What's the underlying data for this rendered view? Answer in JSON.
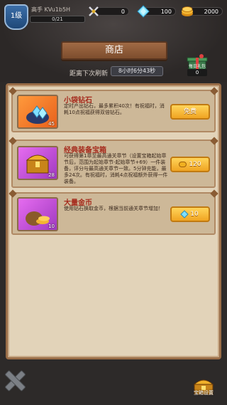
{
  "player": {
    "level": "1级",
    "name": "高手 KVu1b5H",
    "exp": "0/21"
  },
  "resources": {
    "energy": "0",
    "diamonds": "100",
    "gold": "2000"
  },
  "shop": {
    "title": "商店",
    "refresh_label": "距离下次刷新",
    "refresh_timer": "8小时6分43秒"
  },
  "gift": {
    "label": "每日礼包",
    "count": "0"
  },
  "items": [
    {
      "title": "小袋钻石",
      "description": "定时产出钻石，最多累积40次！有祝福时，消耗10点祝福获得双倍钻石。",
      "quantity": "45",
      "button": "免费"
    },
    {
      "title": "经典装备宝箱",
      "description": "可获得第1章至最高通关章节（设置宝箱起始章节后，范围为起始章节-起始章节+69）一件装备，评分与最高通关章节一致。5分钟充能，最多24次。有祝福时，消耗4点祝福额外获得一件装备。",
      "quantity": "28",
      "button": "120"
    },
    {
      "title": "大量金币",
      "description": "使用钻石换取金币，根据当前通关章节增加！",
      "quantity": "10",
      "button": "10"
    }
  ],
  "bottom": {
    "chest_label": "宝箱设置"
  },
  "colors": {
    "accent_gold": "#f0a422",
    "title_red": "#a52a1c",
    "panel_bg": "#e2d3b9"
  }
}
